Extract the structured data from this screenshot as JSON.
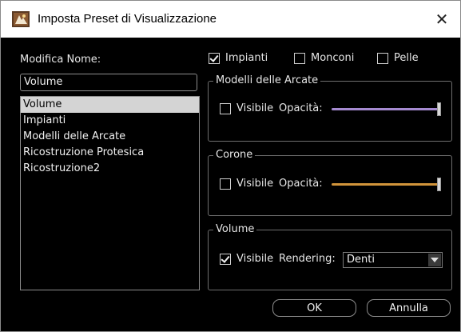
{
  "window": {
    "title": "Imposta Preset di Visualizzazione",
    "close_glyph": "✕"
  },
  "left": {
    "name_label": "Modifica Nome:",
    "name_value": "Volume",
    "list": [
      {
        "label": "Volume",
        "selected": true
      },
      {
        "label": "Impianti",
        "selected": false
      },
      {
        "label": "Modelli delle Arcate",
        "selected": false
      },
      {
        "label": "Ricostruzione Protesica",
        "selected": false
      },
      {
        "label": "Ricostruzione2",
        "selected": false
      }
    ]
  },
  "top_checks": [
    {
      "label": "Impianti",
      "checked": true
    },
    {
      "label": "Monconi",
      "checked": false
    },
    {
      "label": "Pelle",
      "checked": false
    }
  ],
  "groups": {
    "arcate": {
      "title": "Modelli delle Arcate",
      "visible_label": "Visibile",
      "visible_checked": false,
      "opacity_label": "Opacità:",
      "opacity_value": 1.0,
      "color": "#a58ad0"
    },
    "corone": {
      "title": "Corone",
      "visible_label": "Visibile",
      "visible_checked": false,
      "opacity_label": "Opacità:",
      "opacity_value": 1.0,
      "color": "#d1943b"
    },
    "volume": {
      "title": "Volume",
      "visible_label": "Visibile",
      "visible_checked": true,
      "rendering_label": "Rendering:",
      "rendering_value": "Denti"
    }
  },
  "buttons": {
    "ok": "OK",
    "cancel": "Annulla"
  }
}
